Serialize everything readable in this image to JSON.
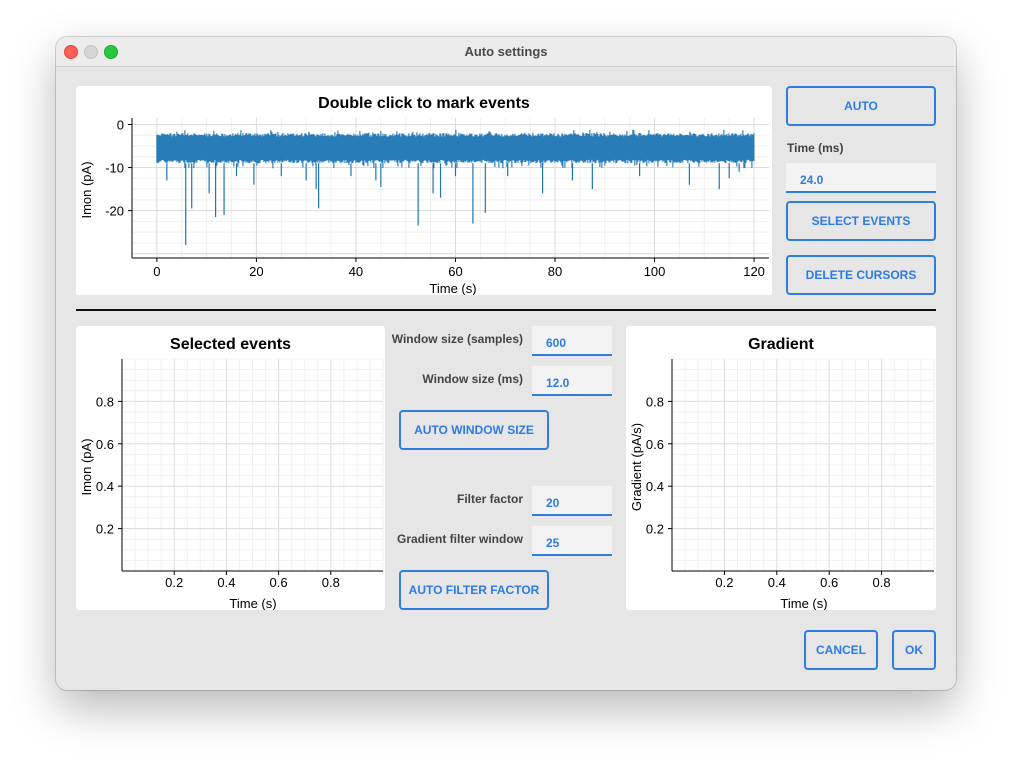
{
  "window": {
    "title": "Auto settings"
  },
  "main_plot": {
    "title": "Double click to mark events",
    "xlabel": "Time (s)",
    "ylabel": "Imon (pA)",
    "x_ticks": [
      "0",
      "20",
      "40",
      "60",
      "80",
      "100",
      "120"
    ],
    "y_ticks": [
      "0",
      "-10",
      "-20"
    ]
  },
  "right_panel": {
    "auto_label": "AUTO",
    "time_label": "Time (ms)",
    "time_value": "24.0",
    "select_events_label": "SELECT EVENTS",
    "delete_cursors_label": "DELETE CURSORS"
  },
  "selected_plot": {
    "title": "Selected events",
    "xlabel": "Time (s)",
    "ylabel": "Imon (pA)",
    "x_ticks": [
      "0.2",
      "0.4",
      "0.6",
      "0.8"
    ],
    "y_ticks": [
      "0.8",
      "0.6",
      "0.4",
      "0.2"
    ]
  },
  "gradient_plot": {
    "title": "Gradient",
    "xlabel": "Time (s)",
    "ylabel": "Gradient (pA/s)",
    "x_ticks": [
      "0.2",
      "0.4",
      "0.6",
      "0.8"
    ],
    "y_ticks": [
      "0.8",
      "0.6",
      "0.4",
      "0.2"
    ]
  },
  "middle_panel": {
    "window_size_samples_label": "Window size (samples)",
    "window_size_samples_value": "600",
    "window_size_ms_label": "Window size (ms)",
    "window_size_ms_value": "12.0",
    "auto_window_size_label": "AUTO WINDOW SIZE",
    "filter_factor_label": "Filter factor",
    "filter_factor_value": "20",
    "gradient_filter_window_label": "Gradient filter window",
    "gradient_filter_window_value": "25",
    "auto_filter_factor_label": "AUTO FILTER FACTOR"
  },
  "footer": {
    "cancel_label": "CANCEL",
    "ok_label": "OK"
  },
  "chart_data": [
    {
      "type": "line",
      "title": "Double click to mark events",
      "xlabel": "Time (s)",
      "ylabel": "Imon (pA)",
      "xlim": [
        -5,
        123
      ],
      "ylim": [
        -31,
        1.5
      ],
      "grid": true,
      "series": [
        {
          "color": "#1f77b4",
          "x_range": [
            0,
            120
          ],
          "baseline_range": [
            -9,
            -2
          ],
          "spike_events": [
            {
              "x": 2,
              "y": -13
            },
            {
              "x": 5.8,
              "y": -28
            },
            {
              "x": 7,
              "y": -19.5
            },
            {
              "x": 10.5,
              "y": -16
            },
            {
              "x": 11.8,
              "y": -21.5
            },
            {
              "x": 13.5,
              "y": -21
            },
            {
              "x": 16,
              "y": -12
            },
            {
              "x": 19.5,
              "y": -14
            },
            {
              "x": 25,
              "y": -12
            },
            {
              "x": 30,
              "y": -13
            },
            {
              "x": 32,
              "y": -15
            },
            {
              "x": 32.5,
              "y": -19.5
            },
            {
              "x": 39,
              "y": -12
            },
            {
              "x": 44,
              "y": -13
            },
            {
              "x": 45,
              "y": -14.5
            },
            {
              "x": 52.5,
              "y": -23.5
            },
            {
              "x": 55.5,
              "y": -16
            },
            {
              "x": 57,
              "y": -17
            },
            {
              "x": 60,
              "y": -12
            },
            {
              "x": 63.5,
              "y": -23
            },
            {
              "x": 66,
              "y": -20.5
            },
            {
              "x": 70.5,
              "y": -12
            },
            {
              "x": 77.5,
              "y": -16
            },
            {
              "x": 83.5,
              "y": -13
            },
            {
              "x": 87.5,
              "y": -15
            },
            {
              "x": 97,
              "y": -12
            },
            {
              "x": 107,
              "y": -14
            },
            {
              "x": 113,
              "y": -15
            },
            {
              "x": 115,
              "y": -12.5
            },
            {
              "x": 117,
              "y": -11
            }
          ]
        }
      ]
    },
    {
      "type": "line",
      "title": "Selected events",
      "xlabel": "Time (s)",
      "ylabel": "Imon (pA)",
      "xlim": [
        0,
        1
      ],
      "ylim": [
        0,
        1
      ],
      "grid": true,
      "series": []
    },
    {
      "type": "line",
      "title": "Gradient",
      "xlabel": "Time (s)",
      "ylabel": "Gradient (pA/s)",
      "xlim": [
        0,
        1
      ],
      "ylim": [
        0,
        1
      ],
      "grid": true,
      "series": []
    }
  ]
}
